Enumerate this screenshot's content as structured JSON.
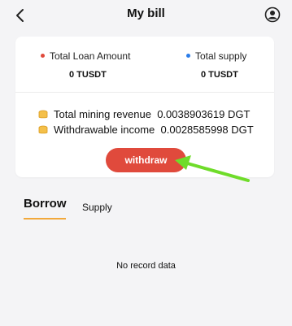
{
  "header": {
    "title": "My bill",
    "back_icon": "chevron-left-icon",
    "profile_icon": "user-circle-icon"
  },
  "summary": {
    "loan_label": "Total Loan Amount",
    "loan_value": "0 TUSDT",
    "loan_dot_color": "#e04a3c",
    "supply_label": "Total supply",
    "supply_value": "0 TUSDT",
    "supply_dot_color": "#2b7de9"
  },
  "income": {
    "mining_label": "Total mining revenue",
    "mining_value": "0.0038903619 DGT",
    "withdrawable_label": "Withdrawable income",
    "withdrawable_value": "0.0028585998 DGT",
    "coin_icon": "coins-icon"
  },
  "actions": {
    "withdraw_label": "withdraw"
  },
  "tabs": [
    {
      "label": "Borrow",
      "active": true
    },
    {
      "label": "Supply",
      "active": false
    }
  ],
  "records": {
    "empty_message": "No record data"
  },
  "colors": {
    "accent": "#e04a3c",
    "tab_underline": "#f2a93b",
    "annotation_arrow": "#6fdc2a"
  }
}
